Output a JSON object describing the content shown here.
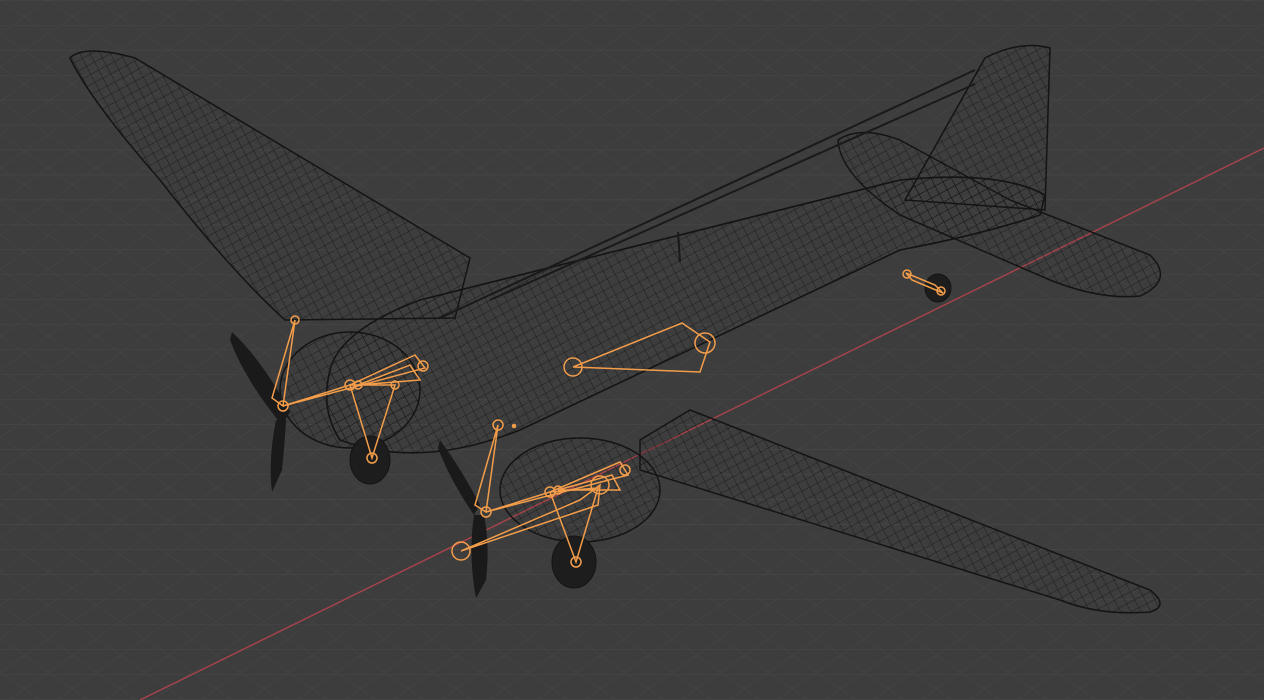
{
  "viewport": {
    "view": "3D Viewport",
    "shading": "wireframe",
    "background_color": "#3d3d3d",
    "grid_color": "#474747",
    "x_axis_color": "#a4434b"
  },
  "scene": {
    "mesh_object": "airplane",
    "mesh_color": "#141414",
    "armature_selected_color": "#f39d4a"
  }
}
